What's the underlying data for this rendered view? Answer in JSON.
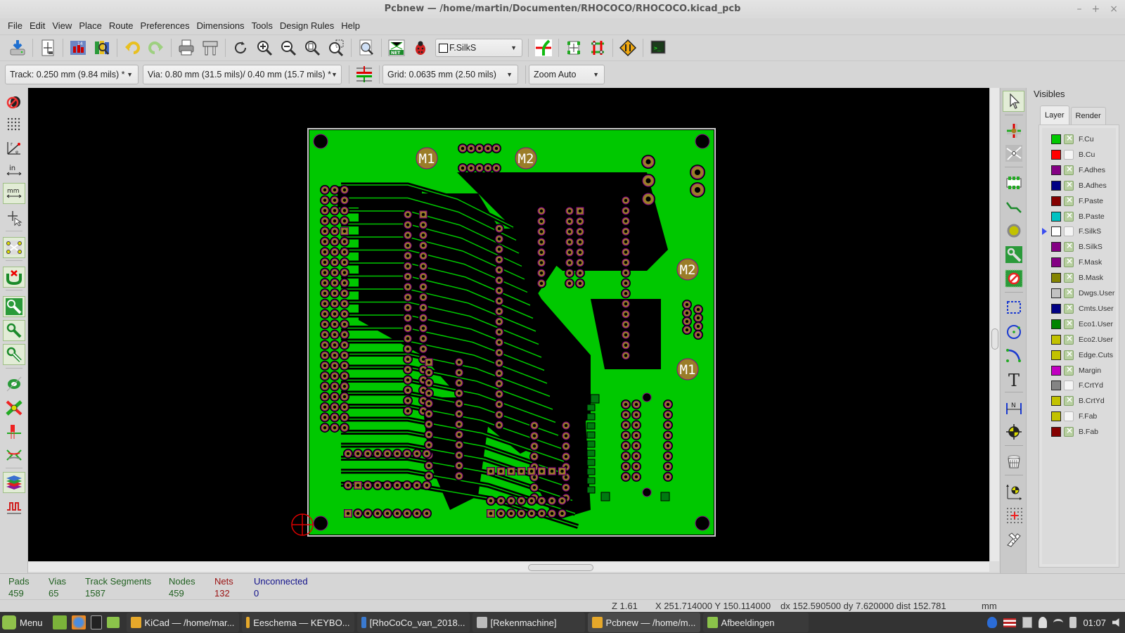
{
  "window": {
    "title": "Pcbnew — /home/martin/Documenten/RHOCOCO/RHOCOCO.kicad_pcb",
    "controls": [
      "–",
      "+",
      "×"
    ]
  },
  "menu": [
    "File",
    "Edit",
    "View",
    "Place",
    "Route",
    "Preferences",
    "Dimensions",
    "Tools",
    "Design Rules",
    "Help"
  ],
  "toolbar": {
    "buttons": [
      {
        "name": "save-board",
        "icon": "save-icon"
      },
      {
        "name": "page-settings",
        "icon": "page-settings-icon"
      },
      {
        "name": "load-module",
        "icon": "module-editor-icon"
      },
      {
        "name": "module-viewer",
        "icon": "library-browser-icon"
      },
      {
        "name": "undo",
        "icon": "undo-icon"
      },
      {
        "name": "redo",
        "icon": "redo-icon"
      },
      {
        "name": "print",
        "icon": "print-icon"
      },
      {
        "name": "plot",
        "icon": "plot-icon"
      },
      {
        "name": "redraw",
        "icon": "refresh-icon"
      },
      {
        "name": "zoom-in",
        "icon": "zoom-in-icon"
      },
      {
        "name": "zoom-out",
        "icon": "zoom-out-icon"
      },
      {
        "name": "zoom-fit",
        "icon": "zoom-fit-icon"
      },
      {
        "name": "zoom-selection",
        "icon": "zoom-area-icon"
      },
      {
        "name": "find",
        "icon": "find-icon"
      },
      {
        "name": "read-netlist",
        "icon": "netlist-icon"
      },
      {
        "name": "drc",
        "icon": "drc-bug-icon"
      },
      {
        "name": "layer-pair",
        "icon": "layer-pair-icon"
      },
      {
        "name": "auto-place",
        "icon": "autoplace-icon"
      },
      {
        "name": "auto-route",
        "icon": "autoroute-icon"
      },
      {
        "name": "freeroute",
        "icon": "freeroute-icon"
      },
      {
        "name": "scripting-console",
        "icon": "console-icon"
      }
    ],
    "active_layer": "F.SilkS"
  },
  "toolbar2": {
    "track": "Track: 0.250 mm (9.84 mils) *",
    "via": "Via: 0.80 mm (31.5 mils)/ 0.40 mm (15.7 mils) *",
    "grid": "Grid: 0.0635 mm (2.50 mils)",
    "zoom": "Zoom Auto"
  },
  "left_toolbar": [
    {
      "name": "drc-off",
      "icon": "drc-off-icon",
      "active": false
    },
    {
      "name": "show-grid",
      "icon": "grid-icon",
      "active": false
    },
    {
      "name": "polar-coords",
      "icon": "polar-coords-icon",
      "active": false
    },
    {
      "name": "units-inch",
      "icon": "unit-inch-icon",
      "active": false
    },
    {
      "name": "units-mm",
      "icon": "unit-mm-icon",
      "active": true
    },
    {
      "name": "cursor-shape",
      "icon": "cursor-shape-icon",
      "active": false
    },
    {
      "name": "show-ratsnest",
      "icon": "ratsnest-icon",
      "active": true
    },
    {
      "name": "module-ratsnest",
      "icon": "module-ratsnest-icon",
      "active": true
    },
    {
      "name": "zone-fill",
      "icon": "zone-fill-icon",
      "active": true
    },
    {
      "name": "zone-outline",
      "icon": "zone-outline-icon",
      "active": true
    },
    {
      "name": "zone-sketch",
      "icon": "zone-sketch-icon",
      "active": true
    },
    {
      "name": "pads-sketch",
      "icon": "pad-sketch-icon",
      "active": false
    },
    {
      "name": "via-sketch",
      "icon": "via-sketch-icon",
      "active": false
    },
    {
      "name": "tracks-sketch",
      "icon": "track-sketch-icon",
      "active": false
    },
    {
      "name": "high-contrast",
      "icon": "contrast-icon",
      "active": false
    },
    {
      "name": "layers-manager",
      "icon": "layers-manager-icon",
      "active": true
    },
    {
      "name": "microwave-tools",
      "icon": "microwave-icon",
      "active": false
    }
  ],
  "right_toolbar": [
    {
      "name": "select",
      "icon": "cursor-arrow-icon",
      "active": true
    },
    {
      "name": "highlight-net",
      "icon": "net-highlight-icon",
      "active": false
    },
    {
      "name": "local-ratsnest",
      "icon": "local-ratsnest-icon",
      "active": false
    },
    {
      "name": "add-footprint",
      "icon": "footprint-icon",
      "active": false
    },
    {
      "name": "add-track",
      "icon": "track-icon",
      "active": false
    },
    {
      "name": "add-via",
      "icon": "via-icon",
      "active": false
    },
    {
      "name": "add-zone",
      "icon": "zone-icon",
      "active": false
    },
    {
      "name": "add-keepout",
      "icon": "keepout-icon",
      "active": false
    },
    {
      "name": "add-line",
      "icon": "graphic-line-icon",
      "active": false
    },
    {
      "name": "add-circle",
      "icon": "circle-icon",
      "active": false
    },
    {
      "name": "add-arc",
      "icon": "arc-icon",
      "active": false
    },
    {
      "name": "add-text",
      "icon": "text-icon",
      "active": false
    },
    {
      "name": "add-dimension",
      "icon": "dimension-icon",
      "active": false
    },
    {
      "name": "add-target",
      "icon": "target-icon",
      "active": false
    },
    {
      "name": "delete",
      "icon": "delete-basket-icon",
      "active": false
    },
    {
      "name": "set-origin",
      "icon": "drill-origin-icon",
      "active": false
    },
    {
      "name": "grid-origin",
      "icon": "grid-origin-icon",
      "active": false
    },
    {
      "name": "measure",
      "icon": "caliper-icon",
      "active": false
    }
  ],
  "visibles": {
    "title": "Visibles",
    "tabs": [
      {
        "label": "Layer",
        "active": true
      },
      {
        "label": "Render",
        "active": false
      }
    ],
    "layers": [
      {
        "name": "F.Cu",
        "color": "#00c800",
        "visible": true,
        "current": false
      },
      {
        "name": "B.Cu",
        "color": "#ff0000",
        "visible": false,
        "current": false
      },
      {
        "name": "F.Adhes",
        "color": "#840084",
        "visible": true,
        "current": false
      },
      {
        "name": "B.Adhes",
        "color": "#000084",
        "visible": true,
        "current": false
      },
      {
        "name": "F.Paste",
        "color": "#840000",
        "visible": true,
        "current": false
      },
      {
        "name": "B.Paste",
        "color": "#00c2c2",
        "visible": true,
        "current": false
      },
      {
        "name": "F.SilkS",
        "color": "#ffffff",
        "visible": false,
        "current": true
      },
      {
        "name": "B.SilkS",
        "color": "#840084",
        "visible": true,
        "current": false
      },
      {
        "name": "F.Mask",
        "color": "#840084",
        "visible": true,
        "current": false
      },
      {
        "name": "B.Mask",
        "color": "#848400",
        "visible": true,
        "current": false
      },
      {
        "name": "Dwgs.User",
        "color": "#c2c2c2",
        "visible": true,
        "current": false
      },
      {
        "name": "Cmts.User",
        "color": "#000084",
        "visible": true,
        "current": false
      },
      {
        "name": "Eco1.User",
        "color": "#008400",
        "visible": true,
        "current": false
      },
      {
        "name": "Eco2.User",
        "color": "#c2c200",
        "visible": true,
        "current": false
      },
      {
        "name": "Edge.Cuts",
        "color": "#c2c200",
        "visible": true,
        "current": false
      },
      {
        "name": "Margin",
        "color": "#c200c2",
        "visible": true,
        "current": false
      },
      {
        "name": "F.CrtYd",
        "color": "#848484",
        "visible": false,
        "current": false
      },
      {
        "name": "B.CrtYd",
        "color": "#c2c200",
        "visible": true,
        "current": false
      },
      {
        "name": "F.Fab",
        "color": "#c2c200",
        "visible": false,
        "current": false
      },
      {
        "name": "B.Fab",
        "color": "#840000",
        "visible": true,
        "current": false
      }
    ]
  },
  "board": {
    "copper_color": "#00c800",
    "pad_color": "#9a7d28",
    "labels": [
      "M1",
      "M2",
      "M2",
      "M1"
    ]
  },
  "stats": [
    {
      "label": "Pads",
      "value": "459",
      "color": "#1f5f1f"
    },
    {
      "label": "Vias",
      "value": "65",
      "color": "#1f5f1f"
    },
    {
      "label": "Track Segments",
      "value": "1587",
      "color": "#1f5f1f"
    },
    {
      "label": "Nodes",
      "value": "459",
      "color": "#1f5f1f"
    },
    {
      "label": "Nets",
      "value": "132",
      "color": "#9a1010"
    },
    {
      "label": "Unconnected",
      "value": "0",
      "color": "#10108a"
    }
  ],
  "status": {
    "zoom": "Z 1.61",
    "xy": "X 251.714000  Y 150.114000",
    "delta": "dx 152.590500  dy 7.620000  dist 152.781",
    "units": "mm"
  },
  "taskbar": {
    "menu_label": "Menu",
    "windows": [
      {
        "label": "KiCad — /home/mar...",
        "active": false
      },
      {
        "label": "Eeschema — KEYBO...",
        "active": false
      },
      {
        "label": "[RhoCoCo_van_2018...",
        "active": false
      },
      {
        "label": "[Rekenmachine]",
        "active": false
      },
      {
        "label": "Pcbnew — /home/m...",
        "active": true
      },
      {
        "label": "Afbeeldingen",
        "active": false
      }
    ],
    "clock": "01:07"
  }
}
